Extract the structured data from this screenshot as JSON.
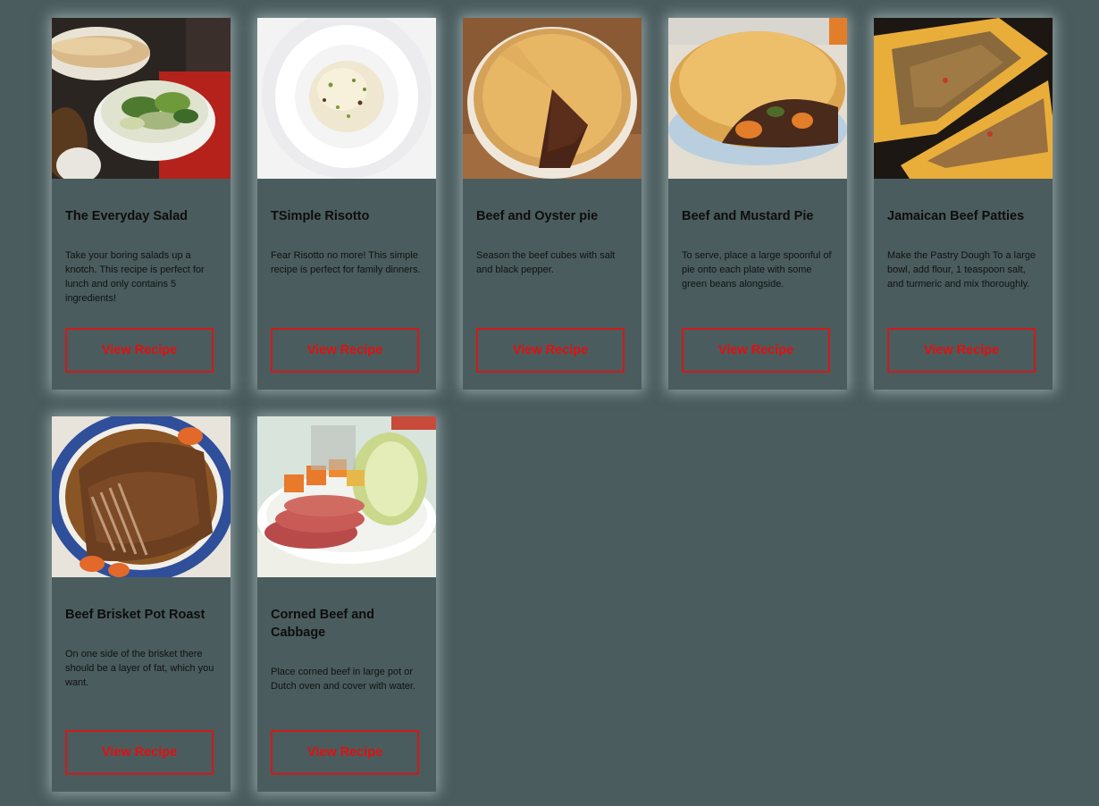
{
  "recipes": [
    {
      "title": "The Everyday Salad",
      "description": "Take your boring salads up a knotch. This recipe is perfect for lunch and only contains 5 ingredients!",
      "button_label": "View Recipe",
      "image_icon": "salad-image"
    },
    {
      "title": "TSimple Risotto",
      "description": "Fear Risotto no more! This simple recipe is perfect for family dinners.",
      "button_label": "View Recipe",
      "image_icon": "risotto-image"
    },
    {
      "title": "Beef and Oyster pie",
      "description": "Season the beef cubes with salt and black pepper.",
      "button_label": "View Recipe",
      "image_icon": "oyster-pie-image"
    },
    {
      "title": "Beef and Mustard Pie",
      "description": "To serve, place a large spoonful of pie onto each plate with some green beans alongside.",
      "button_label": "View Recipe",
      "image_icon": "mustard-pie-image"
    },
    {
      "title": "Jamaican Beef Patties",
      "description": "Make the Pastry Dough To a large bowl, add flour, 1 teaspoon salt, and turmeric and mix thoroughly.",
      "button_label": "View Recipe",
      "image_icon": "beef-patties-image"
    },
    {
      "title": "Beef Brisket Pot Roast",
      "description": "On one side of the brisket there should be a layer of fat, which you want.",
      "button_label": "View Recipe",
      "image_icon": "brisket-image"
    },
    {
      "title": "Corned Beef and Cabbage",
      "description": "Place corned beef in large pot or Dutch oven and cover with water.",
      "button_label": "View Recipe",
      "image_icon": "corned-beef-image"
    }
  ],
  "colors": {
    "background": "#4a5c5e",
    "button_border": "#d11a1a",
    "button_text": "#e30f0f"
  }
}
